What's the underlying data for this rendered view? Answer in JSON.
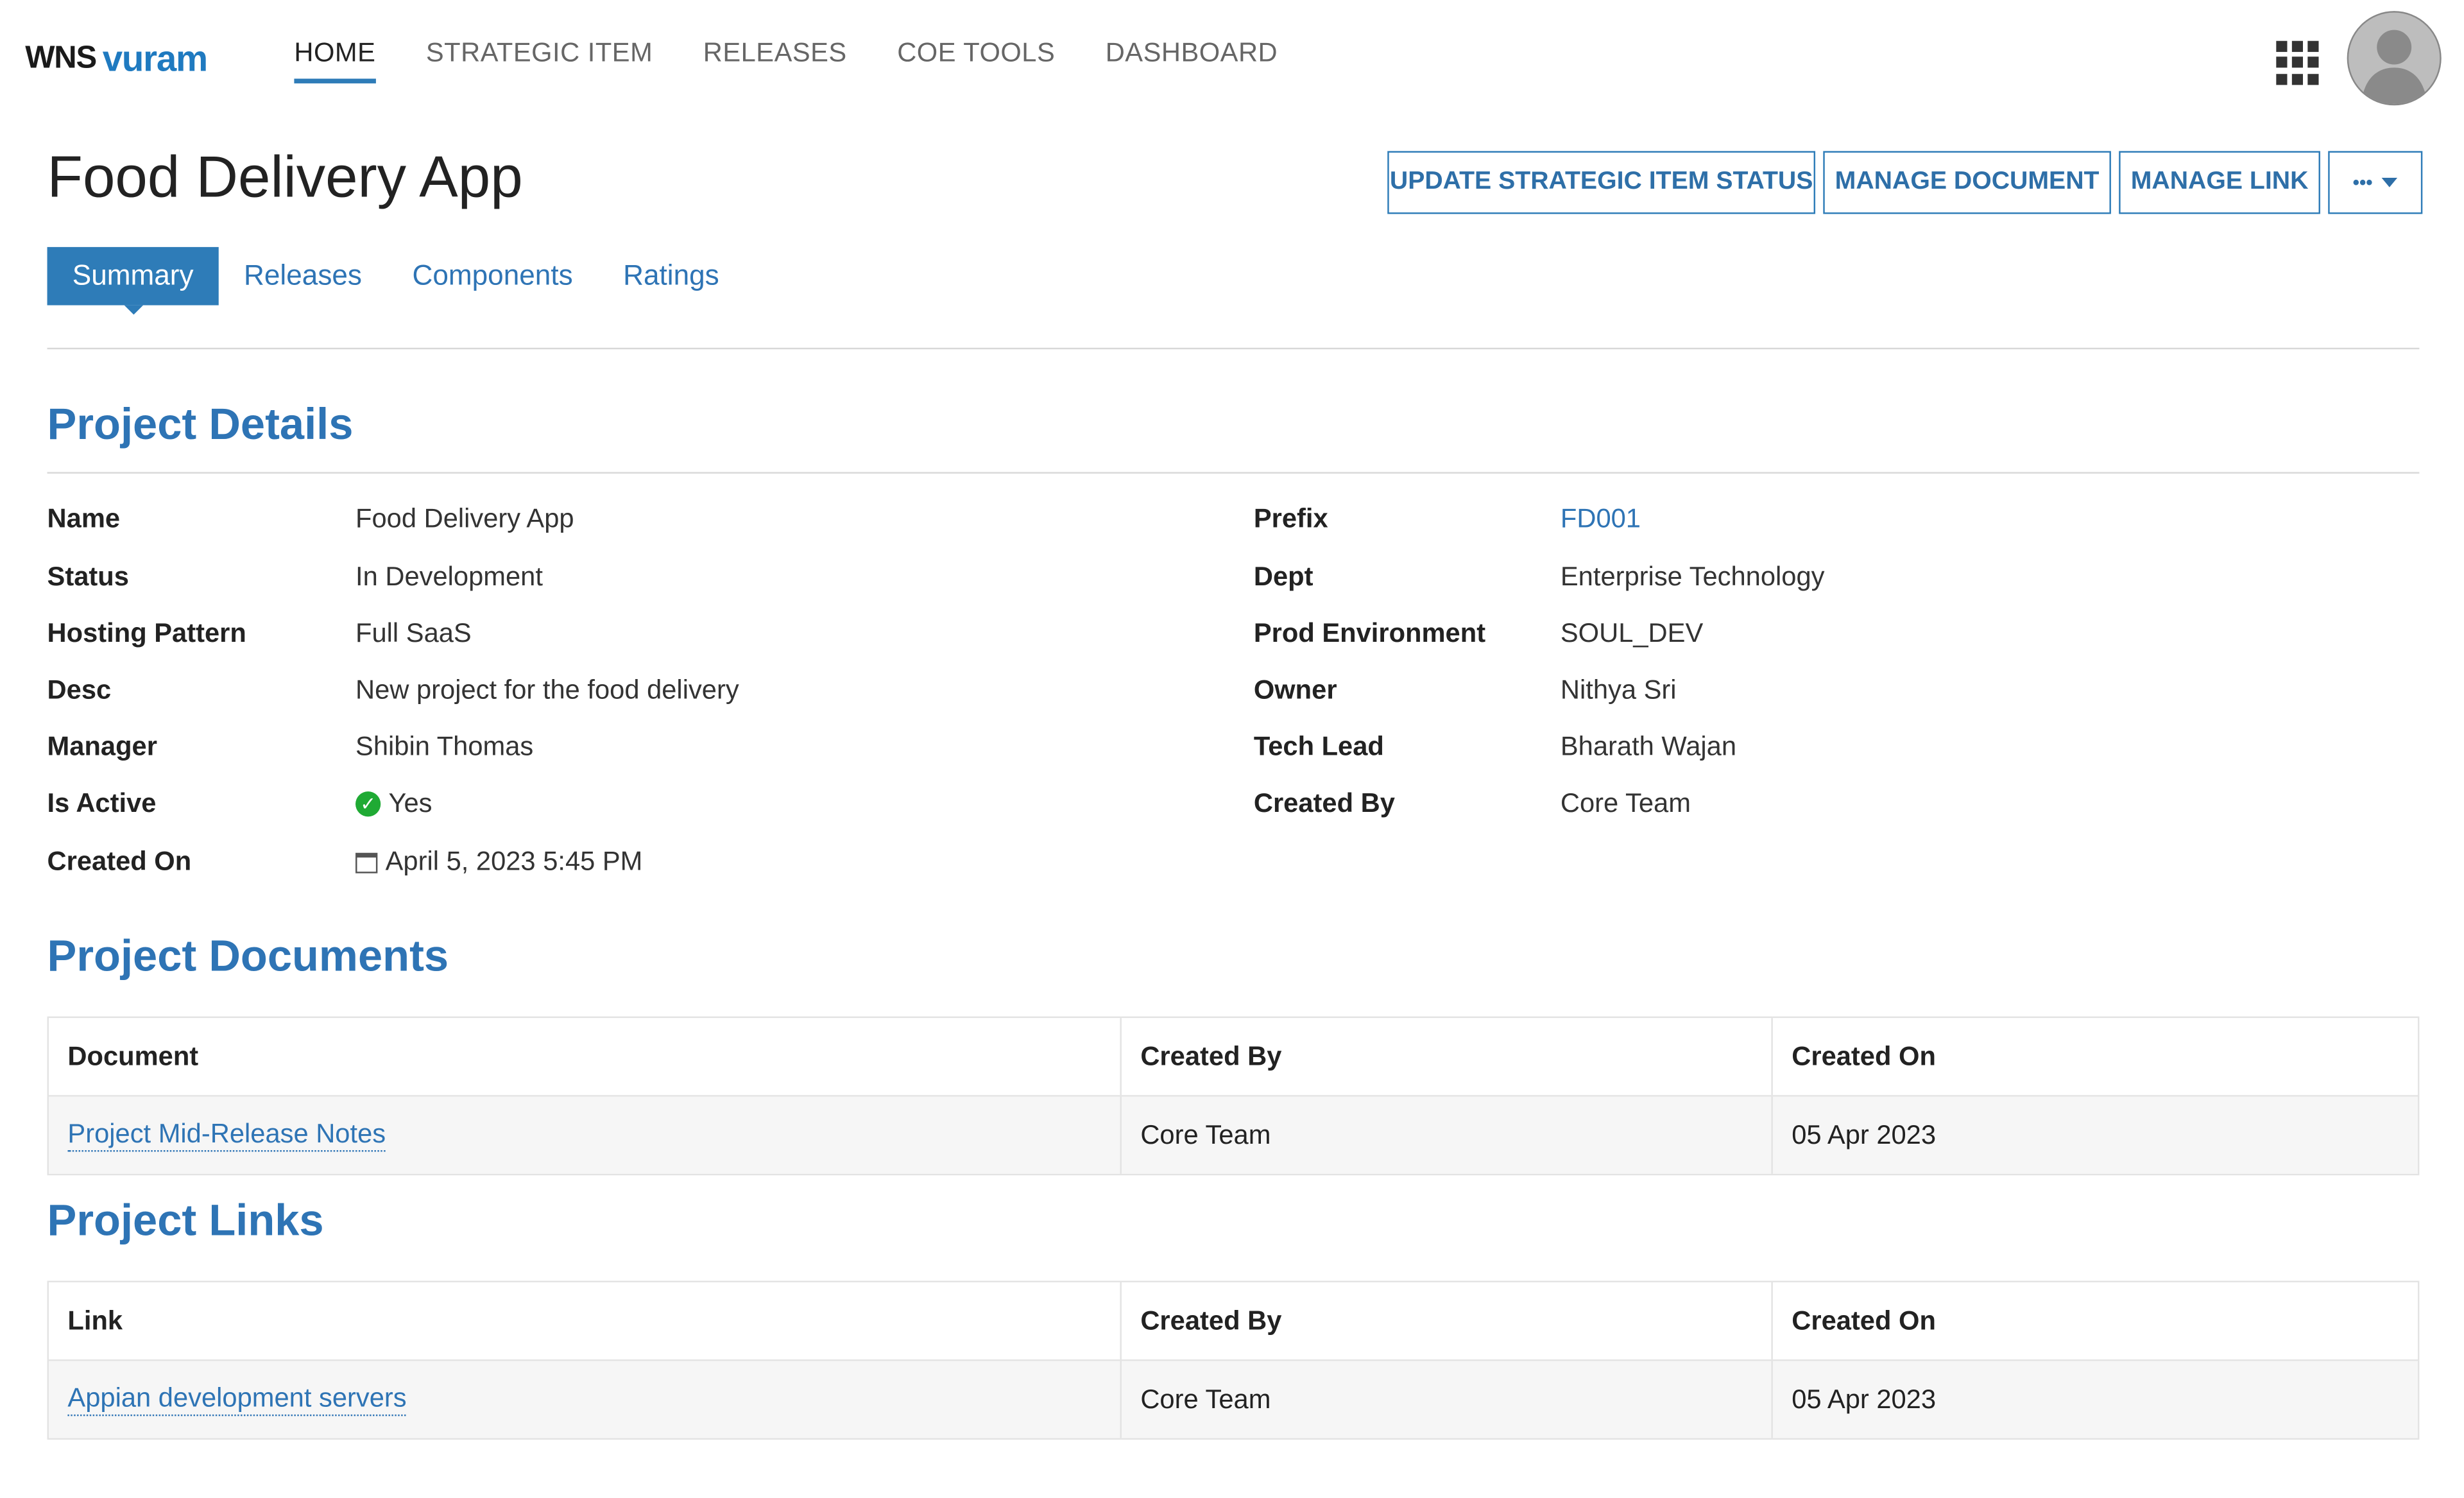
{
  "brand": {
    "part1": "WNS",
    "part2": "vuram"
  },
  "nav": {
    "items": [
      "HOME",
      "STRATEGIC ITEM",
      "RELEASES",
      "COE TOOLS",
      "DASHBOARD"
    ]
  },
  "page_title": "Food Delivery App",
  "actions": {
    "update_status": "UPDATE STRATEGIC ITEM STATUS",
    "manage_document": "MANAGE DOCUMENT",
    "manage_link": "MANAGE LINK",
    "more": "•••"
  },
  "tabs": [
    "Summary",
    "Releases",
    "Components",
    "Ratings"
  ],
  "project_details": {
    "title": "Project Details",
    "left": [
      {
        "label": "Name",
        "value": "Food Delivery App"
      },
      {
        "label": "Status",
        "value": "In Development"
      },
      {
        "label": "Hosting Pattern",
        "value": "Full SaaS"
      },
      {
        "label": "Desc",
        "value": "New project for the food delivery"
      },
      {
        "label": "Manager",
        "value": "Shibin Thomas"
      },
      {
        "label": "Is Active",
        "value": "Yes"
      },
      {
        "label": "Created On",
        "value": "April 5, 2023 5:45 PM"
      }
    ],
    "right": [
      {
        "label": "Prefix",
        "value": "FD001"
      },
      {
        "label": "Dept",
        "value": "Enterprise Technology"
      },
      {
        "label": "Prod Environment",
        "value": "SOUL_DEV"
      },
      {
        "label": "Owner",
        "value": "Nithya Sri"
      },
      {
        "label": "Tech Lead",
        "value": "Bharath Wajan"
      },
      {
        "label": "Created By",
        "value": "Core Team"
      }
    ]
  },
  "project_documents": {
    "title": "Project Documents",
    "columns": [
      "Document",
      "Created By",
      "Created On"
    ],
    "rows": [
      [
        "Project Mid-Release Notes",
        "Core Team",
        "05 Apr 2023"
      ]
    ]
  },
  "project_links": {
    "title": "Project Links",
    "columns": [
      "Link",
      "Created By",
      "Created On"
    ],
    "rows": [
      [
        "Appian development servers",
        "Core Team",
        "05 Apr 2023"
      ]
    ]
  },
  "colors": {
    "accent": "#2e7cb8",
    "link": "#2e74b5",
    "success": "#1faa34"
  }
}
